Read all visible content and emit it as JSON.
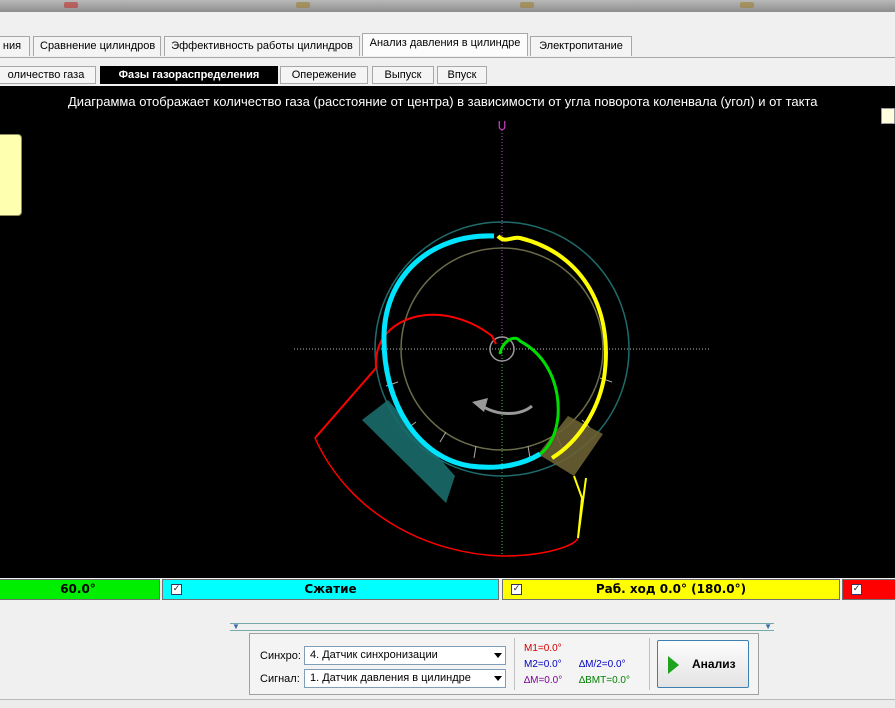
{
  "tabs_main": [
    "ния",
    "Сравнение цилиндров",
    "Эффективность работы цилиндров",
    "Анализ давления в цилиндре",
    "Электропитание"
  ],
  "tabs_main_active": 3,
  "tabs_sub": [
    "оличество газа",
    "Фазы газораспределения",
    "Опережение",
    "Выпуск",
    "Впуск"
  ],
  "tabs_sub_active": 1,
  "caption": "Диаграмма отображает количество газа (расстояние от центра) в зависимости от угла поворота коленвала (угол) и от такта",
  "top_marker": "U",
  "phases": [
    {
      "label": "60.0°",
      "color": "#00ee00",
      "checked": false
    },
    {
      "label": "Сжатие",
      "color": "#00ffff",
      "checked": true
    },
    {
      "label": "Раб. ход 0.0° (180.0°)",
      "color": "#ffff00",
      "checked": true
    },
    {
      "label": "",
      "color": "#ff0000",
      "checked": true
    }
  ],
  "controls": {
    "sync_label": "Синхро:",
    "sync_value": "4.  Датчик синхронизации",
    "signal_label": "Сигнал:",
    "signal_value": "1.  Датчик давления в цилиндре",
    "m1": "M1=0.0°",
    "m2": "M2=0.0°",
    "dm": "∆M=0.0°",
    "dm2": "∆M/2=0.0°",
    "dbmt": "∆BMT=0.0°",
    "analyze": "Анализ"
  },
  "colors": {
    "m1": "#d00000",
    "m2": "#0000c0",
    "dm": "#8000a0",
    "dm2": "#0000c0",
    "dbmt": "#008000"
  }
}
